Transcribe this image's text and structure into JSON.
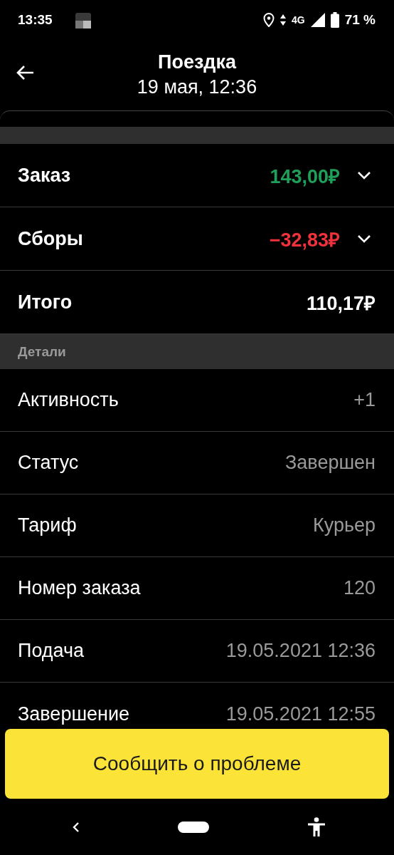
{
  "status_bar": {
    "time": "13:35",
    "network": "4G",
    "battery": "71 %"
  },
  "header": {
    "title": "Поездка",
    "subtitle": "19 мая, 12:36"
  },
  "summary": [
    {
      "label": "Заказ",
      "amount": "143,00₽",
      "color": "#1fa05a",
      "expanded": false
    },
    {
      "label": "Сборы",
      "amount": "−32,83₽",
      "color": "#f0323c",
      "expanded": false
    },
    {
      "label": "Итого",
      "amount": "110,17₽",
      "color": "#ffffff"
    }
  ],
  "details": {
    "heading": "Детали",
    "rows": [
      {
        "label": "Активность",
        "value": "+1"
      },
      {
        "label": "Статус",
        "value": "Завершен"
      },
      {
        "label": "Тариф",
        "value": "Курьер"
      },
      {
        "label": "Номер заказа",
        "value": "120"
      },
      {
        "label": "Подача",
        "value": "19.05.2021 12:36"
      },
      {
        "label": "Завершение",
        "value": "19.05.2021 12:55"
      }
    ]
  },
  "report_button": "Сообщить о проблеме"
}
